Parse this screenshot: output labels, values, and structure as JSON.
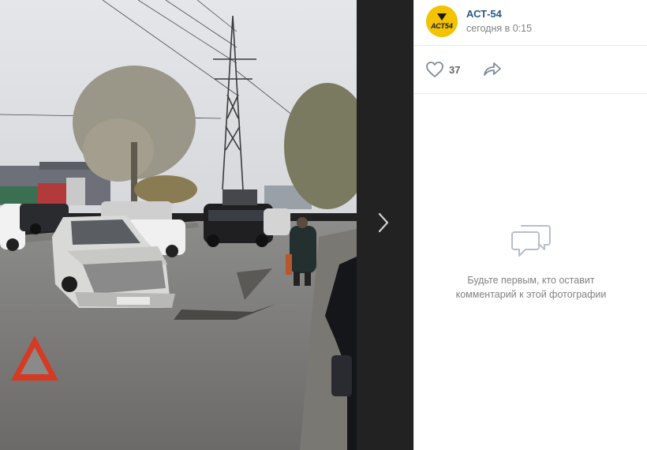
{
  "post": {
    "author": "АСТ-54",
    "time": "сегодня в 0:15",
    "likes": "37"
  },
  "comments": {
    "empty_text": "Будьте первым, кто оставит комментарий к этой фотографии"
  },
  "icons": {
    "like": "heart-icon",
    "share": "share-arrow-icon",
    "next": "chevron-right-icon",
    "empty": "comments-bubble-icon"
  },
  "colors": {
    "link": "#2a5885",
    "secondary_text": "#828282",
    "viewer_background": "#222222",
    "avatar": "#f3c300"
  }
}
